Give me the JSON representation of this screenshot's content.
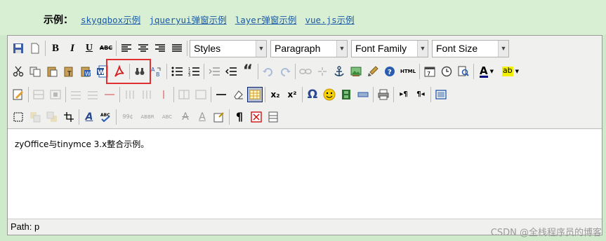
{
  "header": {
    "label": "示例：",
    "links": [
      "skygqbox示例",
      "jqueryui弹窗示例",
      "layer弹窗示例",
      "vue.js示例"
    ]
  },
  "toolbar": {
    "selects": {
      "styles": "Styles",
      "paragraph": "Paragraph",
      "font_family": "Font Family",
      "font_size": "Font Size"
    },
    "glyphs": {
      "bold": "B",
      "italic": "I",
      "underline": "U",
      "strike": "ABC",
      "quote": "“",
      "html": "HTML",
      "omega": "Ω",
      "pilcrow": "¶",
      "sub": "x₂",
      "sup": "x²",
      "text_color": "A",
      "bg_color": "ab"
    }
  },
  "content": {
    "text": "zyOffice与tinymce 3.x整合示例。"
  },
  "statusbar": {
    "path": "Path: p"
  },
  "watermark": "CSDN @全栈程序员的博客"
}
